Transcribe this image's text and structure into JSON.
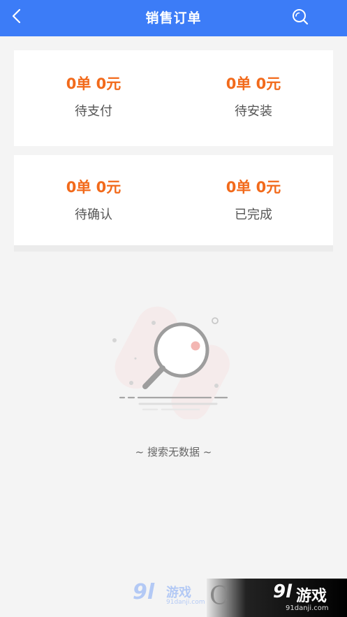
{
  "header": {
    "title": "销售订单",
    "back_icon": "chevron-left-icon",
    "search_icon": "search-icon",
    "bar_color": "#3c7cf7"
  },
  "summary": {
    "value_color": "#f26a1b",
    "cards": [
      {
        "items": [
          {
            "value": "0单 0元",
            "label": "待支付"
          },
          {
            "value": "0单 0元",
            "label": "待安装"
          }
        ]
      },
      {
        "items": [
          {
            "value": "0单 0元",
            "label": "待确认"
          },
          {
            "value": "0单 0元",
            "label": "已完成"
          }
        ]
      }
    ]
  },
  "empty_state": {
    "icon": "magnifier-illustration",
    "text": "~ 搜索无数据 ~"
  },
  "watermark": {
    "left": {
      "mark": "9l",
      "name": "游戏",
      "url": "91danji.com"
    },
    "right": {
      "letter": "C",
      "mark": "9l",
      "name": "游戏",
      "url": "91danji.com"
    }
  }
}
